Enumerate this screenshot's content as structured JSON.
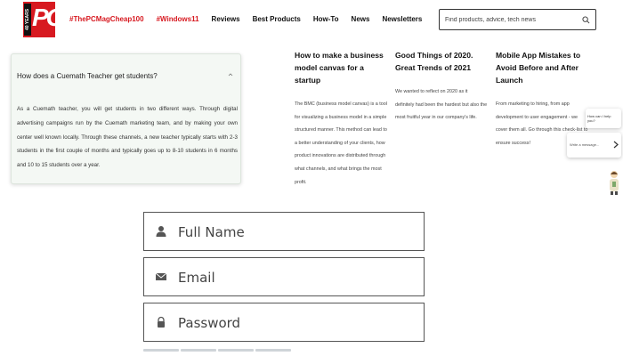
{
  "header": {
    "logo_years": "40 YEARS",
    "logo_text": "PC",
    "nav": [
      {
        "label": "#ThePCMagCheap100",
        "hot": true
      },
      {
        "label": "#Windows11",
        "hot": true
      },
      {
        "label": "Reviews",
        "hot": false
      },
      {
        "label": "Best Products",
        "hot": false
      },
      {
        "label": "How-To",
        "hot": false
      },
      {
        "label": "News",
        "hot": false
      },
      {
        "label": "Newsletters",
        "hot": false
      }
    ],
    "search_placeholder": "Find products, advice, tech news"
  },
  "faq": {
    "question": "How does a Cuemath Teacher get students?",
    "answer": "As a Cuemath teacher, you will get students in two different ways. Through digital advertising campaigns run by the Cuemath marketing team, and by making your own center well known locally. Through these channels, a new teacher typically starts with 2-3 students in the first couple of months and typically goes up to 8-10 students in 6 months and 10 to 15 students over a year."
  },
  "articles": [
    {
      "title": "How to make a business model canvas for a startup",
      "summary": "The BMC (business model canvas) is a tool for visualizing a business model in a simple structured manner. This method can lead to a better understanding of your clients, how product innovations are distributed through what channels, and what brings the most profit."
    },
    {
      "title": "Good Things of 2020. Great Trends of 2021",
      "summary": "We wanted to reflect on 2020 as it definitely had been the hardest but also the most fruitful year in our company's life."
    },
    {
      "title": "Mobile App Mistakes to Avoid Before and After Launch",
      "summary": "From marketing to hiring, from app development to user engagement - we cover them all. Go through this check-list to ensure success!"
    }
  ],
  "chat": {
    "bubble": "How can I help you?",
    "input_placeholder": "Write a message..."
  },
  "form": {
    "full_name_placeholder": "Full Name",
    "email_placeholder": "Email",
    "password_placeholder": "Password",
    "progress_segments": 4
  },
  "colors": {
    "brand_red": "#d71920",
    "faq_bg": "#f4f8f4"
  }
}
